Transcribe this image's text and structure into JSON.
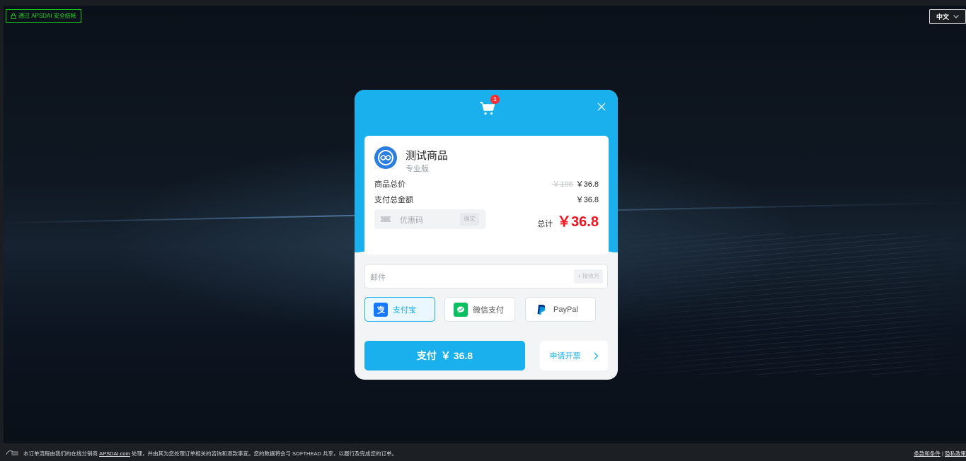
{
  "header": {
    "secure_badge": "通过 APSDAI 安全结帐",
    "language": "中文"
  },
  "cart": {
    "badge_count": "1"
  },
  "product": {
    "name": "测试商品",
    "edition": "专业版",
    "subtotal_label": "商品总价",
    "original_price": "￥198",
    "subtotal_price": "￥36.8",
    "payment_total_label": "支付总金额",
    "payment_total_value": "￥36.8"
  },
  "coupon": {
    "placeholder": "优惠码",
    "apply_label": "确定"
  },
  "total": {
    "label": "总计",
    "value": "￥36.8"
  },
  "email": {
    "placeholder": "邮件",
    "tag": "+ 接收方"
  },
  "payment_methods": [
    {
      "label": "支付宝",
      "selected": true,
      "icon": "alipay-icon",
      "color": "#1677ff"
    },
    {
      "label": "微信支付",
      "selected": false,
      "icon": "wechat-pay-icon",
      "color": "#07c160"
    },
    {
      "label": "PayPal",
      "selected": false,
      "icon": "paypal-icon",
      "color": "#003087"
    }
  ],
  "actions": {
    "pay_label": "支付",
    "pay_amount": "￥ 36.8",
    "invoice_label": "申请开票"
  },
  "footer": {
    "text_before": "本订单流程由我们的在线分销商",
    "distributor_link": "APSDAI.com",
    "text_after": "处理，并由其为您处理订单相关的咨询和退款事宜。您的数据将会与 SOFTHEAD 共享，以履行及完成您的订单。",
    "terms_link": "条款和条件",
    "privacy_link": "隐私政策"
  },
  "colors": {
    "accent": "#1ab0ee",
    "price_red": "#f0141e",
    "secure_green": "#24d424"
  }
}
